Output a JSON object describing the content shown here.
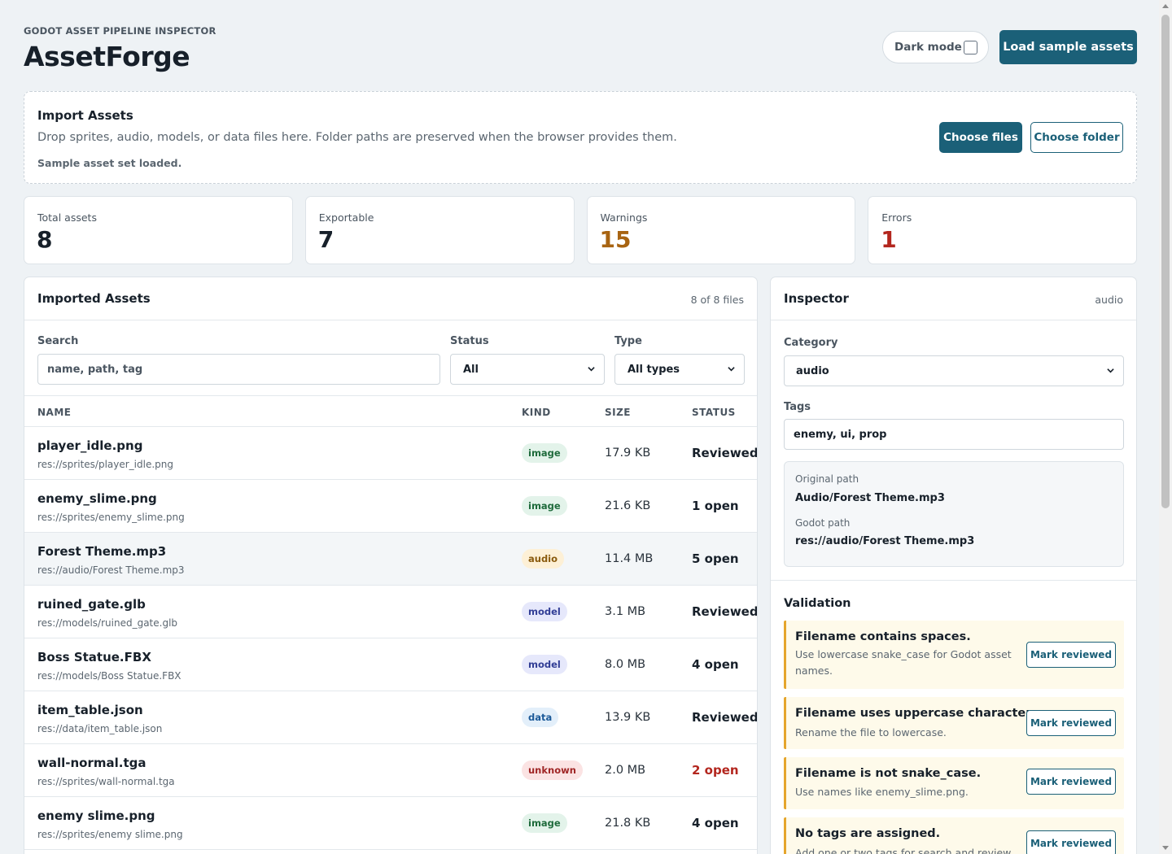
{
  "header": {
    "eyebrow": "GODOT ASSET PIPELINE INSPECTOR",
    "title": "AssetForge",
    "dark_mode_label": "Dark mode",
    "dark_mode_checked": false,
    "load_sample_label": "Load sample assets"
  },
  "import": {
    "title": "Import Assets",
    "description": "Drop sprites, audio, models, or data files here. Folder paths are preserved when the browser provides them.",
    "status": "Sample asset set loaded.",
    "choose_files_label": "Choose files",
    "choose_folder_label": "Choose folder"
  },
  "stats": [
    {
      "label": "Total assets",
      "value": "8",
      "color": "#17202a"
    },
    {
      "label": "Exportable",
      "value": "7",
      "color": "#17202a"
    },
    {
      "label": "Warnings",
      "value": "15",
      "color": "#a86412"
    },
    {
      "label": "Errors",
      "value": "1",
      "color": "#b3261e"
    }
  ],
  "assets": {
    "title": "Imported Assets",
    "count_text": "8 of 8 files",
    "filters": {
      "search_label": "Search",
      "search_placeholder": "name, path, tag",
      "status_label": "Status",
      "status_value": "All",
      "type_label": "Type",
      "type_value": "All types"
    },
    "columns": [
      "NAME",
      "KIND",
      "SIZE",
      "STATUS"
    ],
    "rows": [
      {
        "name": "player_idle.png",
        "path": "res://sprites/player_idle.png",
        "kind": "image",
        "size": "17.9 KB",
        "status": "Reviewed"
      },
      {
        "name": "enemy_slime.png",
        "path": "res://sprites/enemy_slime.png",
        "kind": "image",
        "size": "21.6 KB",
        "status": "1 open"
      },
      {
        "name": "Forest Theme.mp3",
        "path": "res://audio/Forest Theme.mp3",
        "kind": "audio",
        "size": "11.4 MB",
        "status": "5 open"
      },
      {
        "name": "ruined_gate.glb",
        "path": "res://models/ruined_gate.glb",
        "kind": "model",
        "size": "3.1 MB",
        "status": "Reviewed"
      },
      {
        "name": "Boss Statue.FBX",
        "path": "res://models/Boss Statue.FBX",
        "kind": "model",
        "size": "8.0 MB",
        "status": "4 open"
      },
      {
        "name": "item_table.json",
        "path": "res://data/item_table.json",
        "kind": "data",
        "size": "13.9 KB",
        "status": "Reviewed"
      },
      {
        "name": "wall-normal.tga",
        "path": "res://sprites/wall-normal.tga",
        "kind": "unknown",
        "size": "2.0 MB",
        "status": "2 open"
      },
      {
        "name": "enemy slime.png",
        "path": "res://sprites/enemy slime.png",
        "kind": "image",
        "size": "21.8 KB",
        "status": "4 open"
      }
    ]
  },
  "inspector": {
    "title": "Inspector",
    "kind": "audio",
    "category_label": "Category",
    "category_value": "audio",
    "tags_label": "Tags",
    "tags_value": "enemy, ui, prop",
    "original_path_label": "Original path",
    "original_path": "Audio/Forest Theme.mp3",
    "godot_path_label": "Godot path",
    "godot_path": "res://audio/Forest Theme.mp3",
    "validation_title": "Validation",
    "issues": [
      {
        "title": "Filename contains spaces.",
        "hint": "Use lowercase snake_case for Godot asset names.",
        "action": "Mark reviewed"
      },
      {
        "title": "Filename uses uppercase characters.",
        "hint": "Rename the file to lowercase.",
        "action": "Mark reviewed"
      },
      {
        "title": "Filename is not snake_case.",
        "hint": "Use names like enemy_slime.png.",
        "action": "Mark reviewed"
      },
      {
        "title": "No tags are assigned.",
        "hint": "Add one or two tags for search and review.",
        "action": "Mark reviewed"
      }
    ]
  }
}
